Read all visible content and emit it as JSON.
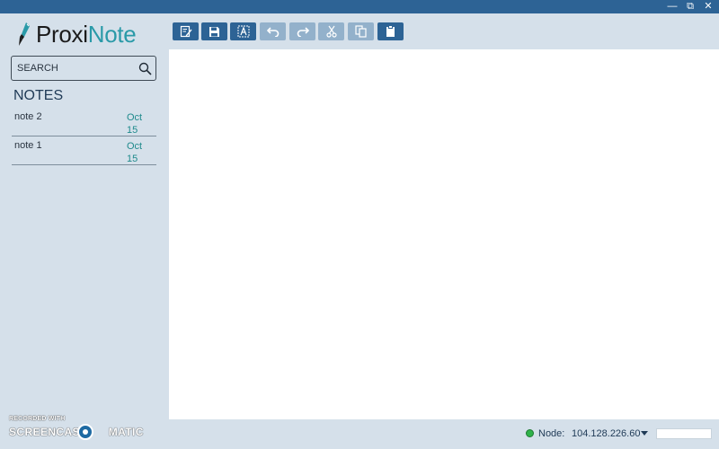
{
  "window_controls": {
    "minimize_label": "—",
    "restore_label": "⧉",
    "close_label": "✕"
  },
  "app": {
    "logo_part1": "Proxi",
    "logo_part2": "Note",
    "brand_color": "#2a9aa8",
    "accent": "#2d6395"
  },
  "toolbar": {
    "buttons": [
      {
        "name": "new-note",
        "icon": "edit-note-icon",
        "enabled": true
      },
      {
        "name": "save",
        "icon": "save-icon",
        "enabled": true
      },
      {
        "name": "select-text",
        "icon": "text-select-icon",
        "enabled": true
      },
      {
        "name": "undo",
        "icon": "undo-icon",
        "enabled": false
      },
      {
        "name": "redo",
        "icon": "redo-icon",
        "enabled": false
      },
      {
        "name": "cut",
        "icon": "scissors-icon",
        "enabled": false
      },
      {
        "name": "copy",
        "icon": "copy-icon",
        "enabled": false
      },
      {
        "name": "paste",
        "icon": "clipboard-icon",
        "enabled": true
      }
    ]
  },
  "sidebar": {
    "search_placeholder": "SEARCH",
    "notes_title": "NOTES",
    "notes": [
      {
        "name": "note 2",
        "month": "Oct",
        "day": "15"
      },
      {
        "name": "note 1",
        "month": "Oct",
        "day": "15"
      }
    ]
  },
  "watermark": {
    "line1": "RECORDED WITH",
    "line2a": "SCREENCAST",
    "line2b": "MATIC"
  },
  "status_bar": {
    "node_label": "Node:",
    "node_address": "104.128.226.60",
    "connection_color": "#2fb24a"
  }
}
